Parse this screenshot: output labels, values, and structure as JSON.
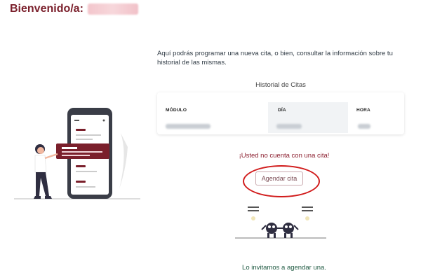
{
  "header": {
    "welcome_label": "Bienvenido/a:"
  },
  "intro": {
    "text": "Aquí podrás programar una nueva cita, o bien, consultar la información sobre tu historial de las mismas."
  },
  "history": {
    "title": "Historial de Citas",
    "columns": [
      "MÓDULO",
      "DÍA",
      "HORA"
    ]
  },
  "status": {
    "no_appointment": "¡Usted no cuenta con una cita!",
    "invite": "Lo invitamos a agendar una."
  },
  "actions": {
    "schedule_label": "Agendar cita"
  },
  "colors": {
    "brand": "#7a1f2b",
    "alert": "#8b1e2e",
    "invite": "#1f5a42",
    "highlight": "#d11b1b"
  }
}
